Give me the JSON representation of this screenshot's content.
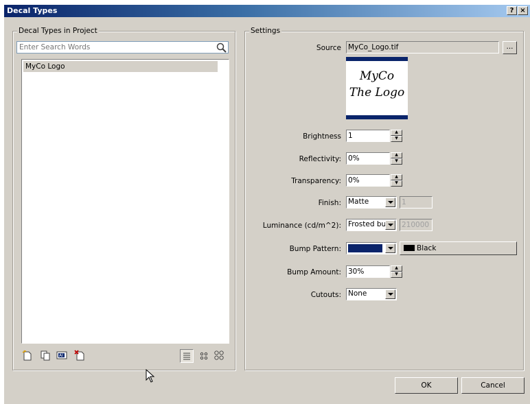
{
  "window": {
    "title": "Decal Types",
    "help_label": "?",
    "close_label": "×"
  },
  "left_panel": {
    "legend": "Decal Types in Project",
    "search_placeholder": "Enter Search Words",
    "items": [
      {
        "label": "MyCo Logo"
      }
    ]
  },
  "settings": {
    "legend": "Settings",
    "source": {
      "label": "Source",
      "value": "MyCo_Logo.tif",
      "browse_label": "..."
    },
    "logo": {
      "line1": "MyCo",
      "line2": "The Logo"
    },
    "brightness": {
      "label": "Brightness",
      "value": "1"
    },
    "reflectivity": {
      "label": "Reflectivity:",
      "value": "0%"
    },
    "transparency": {
      "label": "Transparency:",
      "value": "0%"
    },
    "finish": {
      "label": "Finish:",
      "value": "Matte",
      "extra": "1"
    },
    "luminance": {
      "label": "Luminance (cd/m^2):",
      "value": "Frosted bu",
      "extra": "210000"
    },
    "bump_pattern": {
      "label": "Bump Pattern:",
      "color_name": "Black",
      "swatch_color": "#0a246a"
    },
    "bump_amount": {
      "label": "Bump Amount:",
      "value": "30%"
    },
    "cutouts": {
      "label": "Cutouts:",
      "value": "None"
    }
  },
  "buttons": {
    "ok": "OK",
    "cancel": "Cancel"
  },
  "icons": [
    "new-decal-icon",
    "copy-decal-icon",
    "rename-decal-icon",
    "delete-decal-icon",
    "list-view-icon",
    "small-icons-view-icon",
    "large-icons-view-icon",
    "search-icon",
    "mouse-cursor-icon"
  ]
}
